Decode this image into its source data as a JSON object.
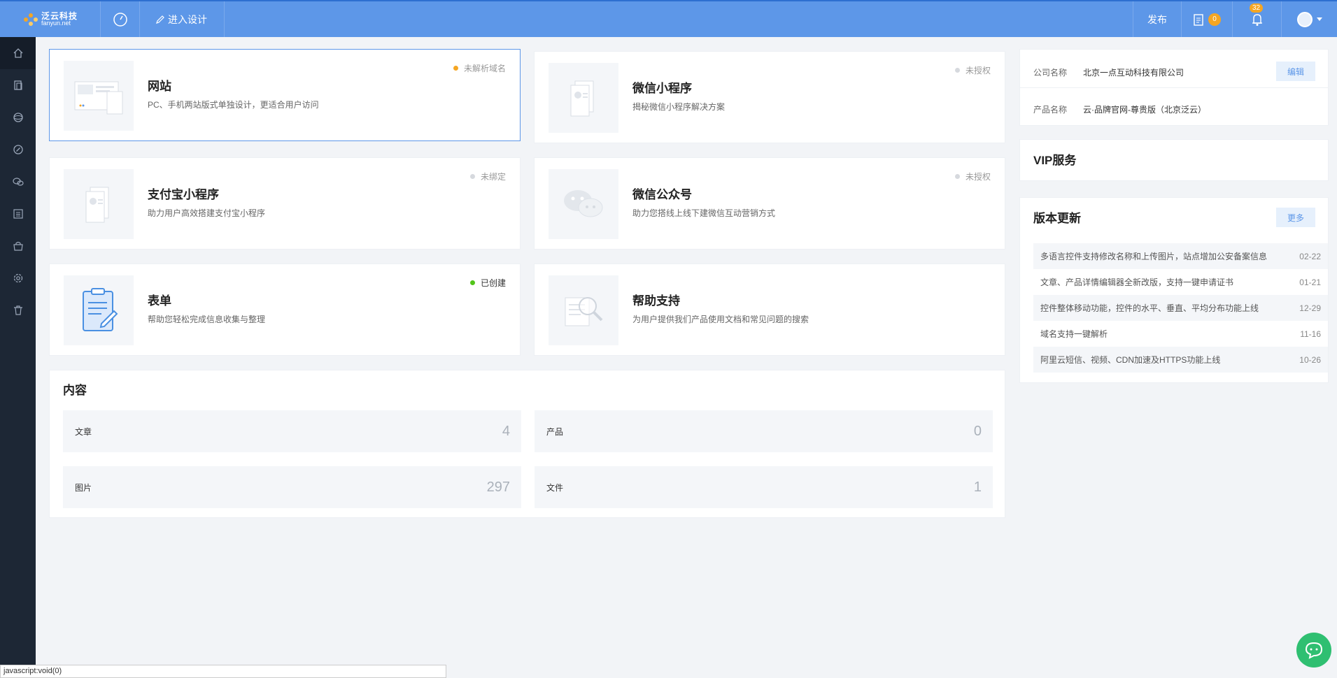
{
  "header": {
    "logo_cn": "泛云科技",
    "logo_en": "fanyun.net",
    "design_label": "进入设计",
    "publish_label": "发布",
    "orders_count": "0",
    "notifications_count": "32"
  },
  "sidebar": {
    "items": [
      {
        "icon": "home-icon"
      },
      {
        "icon": "pages-icon"
      },
      {
        "icon": "globe-icon"
      },
      {
        "icon": "link-icon"
      },
      {
        "icon": "wechat-icon"
      },
      {
        "icon": "list-icon"
      },
      {
        "icon": "shop-icon"
      },
      {
        "icon": "settings-icon"
      },
      {
        "icon": "trash-icon"
      }
    ]
  },
  "products": [
    {
      "title": "网站",
      "desc": "PC、手机两站版式单独设计，更适合用户访问",
      "status": "未解析域名",
      "status_color": "#f5a623"
    },
    {
      "title": "微信小程序",
      "desc": "揭秘微信小程序解决方案",
      "status": "未授权",
      "status_color": "#d6d9de"
    },
    {
      "title": "支付宝小程序",
      "desc": "助力用户高效搭建支付宝小程序",
      "status": "未绑定",
      "status_color": "#d6d9de"
    },
    {
      "title": "微信公众号",
      "desc": "助力您搭线上线下建微信互动营销方式",
      "status": "未授权",
      "status_color": "#d6d9de"
    },
    {
      "title": "表单",
      "desc": "帮助您轻松完成信息收集与整理",
      "status": "已创建",
      "status_color": "#52c41a"
    },
    {
      "title": "帮助支持",
      "desc": "为用户提供我们产品使用文档和常见问题的搜索",
      "status": "",
      "status_color": "#d6d9de"
    }
  ],
  "content": {
    "title": "内容",
    "stats": [
      {
        "label": "文章",
        "value": "4"
      },
      {
        "label": "产品",
        "value": "0"
      },
      {
        "label": "图片",
        "value": "297"
      },
      {
        "label": "文件",
        "value": "1"
      }
    ]
  },
  "company": {
    "name_label": "公司名称",
    "name_value": "北京一点互动科技有限公司",
    "edit_label": "编辑",
    "product_label": "产品名称",
    "product_value": "云·品牌官网-尊贵版（北京泛云）"
  },
  "vip": {
    "title": "VIP服务"
  },
  "updates": {
    "title": "版本更新",
    "more_label": "更多",
    "items": [
      {
        "text": "多语言控件支持修改名称和上传图片，站点增加公安备案信息",
        "date": "02-22"
      },
      {
        "text": "文章、产品详情编辑器全新改版，支持一键申请证书",
        "date": "01-21"
      },
      {
        "text": "控件整体移动功能，控件的水平、垂直、平均分布功能上线",
        "date": "12-29"
      },
      {
        "text": "域名支持一键解析",
        "date": "11-16"
      },
      {
        "text": "阿里云短信、视频、CDN加速及HTTPS功能上线",
        "date": "10-26"
      }
    ]
  },
  "statusbar": {
    "text": "javascript:void(0)"
  }
}
